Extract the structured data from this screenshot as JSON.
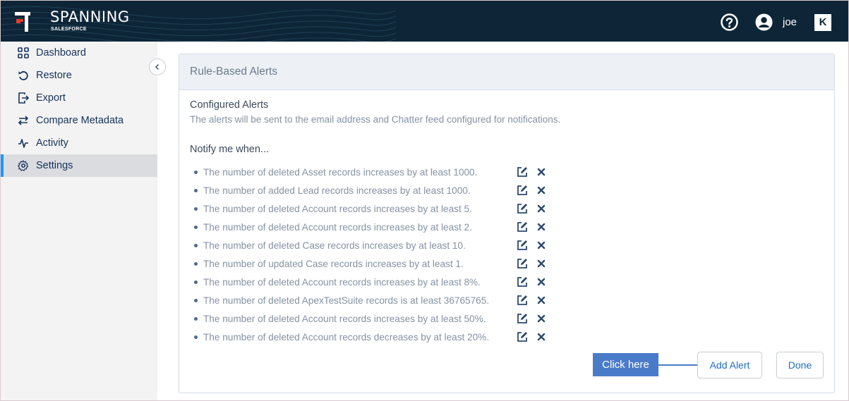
{
  "header": {
    "brand": "SPANNING",
    "brand_sub": "SALESFORCE",
    "username": "joe",
    "k_badge": "K",
    "help_icon": "question-circle-icon",
    "user_icon": "user-circle-icon",
    "bg_color": "#0d2537"
  },
  "sidebar": {
    "items": [
      {
        "label": "Dashboard",
        "icon": "grid-icon"
      },
      {
        "label": "Restore",
        "icon": "restore-icon"
      },
      {
        "label": "Export",
        "icon": "export-icon"
      },
      {
        "label": "Compare Metadata",
        "icon": "swap-arrows-icon"
      },
      {
        "label": "Activity",
        "icon": "pulse-icon"
      },
      {
        "label": "Settings",
        "icon": "gear-icon",
        "active": true
      }
    ],
    "active_color": "#1b96ff"
  },
  "card": {
    "title": "Rule-Based Alerts",
    "configured_title": "Configured Alerts",
    "description": "The alerts will be sent to the email address and Chatter feed configured for notifications.",
    "notify_heading": "Notify me when...",
    "alerts": [
      "The number of deleted Asset records increases by at least 1000.",
      "The number of added Lead records increases by at least 1000.",
      "The number of deleted Account records increases by at least 5.",
      "The number of deleted Account records increases by at least 2.",
      "The number of deleted Case records increases by at least 10.",
      "The number of updated Case records increases by at least 1.",
      "The number of deleted Account records increases by at least 8%.",
      "The number of deleted ApexTestSuite records is at least 36765765.",
      "The number of deleted Account records increases by at least 50%.",
      "The number of deleted Account records decreases by at least 20%."
    ],
    "callout_label": "Click here",
    "add_alert_label": "Add Alert",
    "done_label": "Done"
  }
}
